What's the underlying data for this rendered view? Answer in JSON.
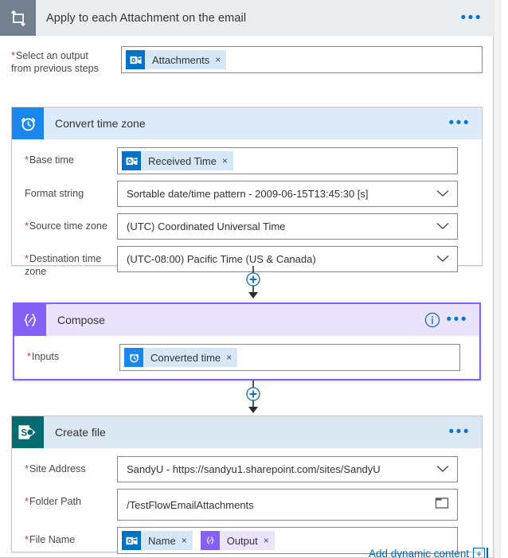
{
  "scope": {
    "title": "Apply to each Attachment on the email",
    "icon": "loop-icon",
    "menu_label": "•••",
    "field": {
      "label_line1": "Select an output",
      "label_line2": "from previous steps",
      "required": true,
      "token": {
        "text": "Attachments",
        "icon": "outlook-icon",
        "remove_label": "×"
      }
    }
  },
  "actions": [
    {
      "id": "convert-time-zone",
      "title": "Convert time zone",
      "icon": "alarm-clock-icon",
      "menu_label": "•••",
      "selected": false,
      "fields": [
        {
          "label": "Base time",
          "required": true,
          "type": "token",
          "token": {
            "text": "Received Time",
            "icon": "outlook-icon",
            "remove_label": "×"
          }
        },
        {
          "label": "Format string",
          "required": false,
          "type": "dropdown",
          "value": "Sortable date/time pattern - 2009-06-15T13:45:30 [s]"
        },
        {
          "label": "Source time zone",
          "required": true,
          "type": "dropdown",
          "value": "(UTC) Coordinated Universal Time"
        },
        {
          "label": "Destination time zone",
          "required": true,
          "type": "dropdown",
          "value": "(UTC-08:00) Pacific Time (US & Canada)"
        }
      ]
    },
    {
      "id": "compose",
      "title": "Compose",
      "icon": "compose-braces-icon",
      "menu_label": "•••",
      "info_label": "i",
      "selected": true,
      "fields": [
        {
          "label": "Inputs",
          "required": true,
          "type": "token",
          "token": {
            "text": "Converted time",
            "icon": "alarm-clock-icon",
            "remove_label": "×"
          }
        }
      ]
    },
    {
      "id": "create-file",
      "title": "Create file",
      "icon": "sharepoint-icon",
      "menu_label": "•••",
      "selected": false,
      "fields": [
        {
          "label": "Site Address",
          "required": true,
          "type": "dropdown",
          "value": "SandyU - https://sandyu1.sharepoint.com/sites/SandyU"
        },
        {
          "label": "Folder Path",
          "required": true,
          "type": "text-with-picker",
          "value": "/TestFlowEmailAttachments",
          "picker_icon": "folder-icon"
        },
        {
          "label": "File Name",
          "required": true,
          "type": "tokens",
          "tokens": [
            {
              "text": "Name",
              "icon": "outlook-icon",
              "remove_label": "×"
            },
            {
              "text": "Output",
              "icon": "compose-braces-icon",
              "remove_label": "×"
            }
          ]
        }
      ]
    }
  ],
  "connectors": [
    {
      "id": "connector-1",
      "add_label": "+"
    },
    {
      "id": "connector-2",
      "add_label": "+"
    }
  ],
  "footer": {
    "add_dynamic_content": "Add dynamic content",
    "add_dynamic_plus": "+"
  },
  "colors": {
    "scope_header_bg": "#eaedf0",
    "scope_icon_bg": "#72808f",
    "card_header_blue": "#dceafa",
    "card_header_purple": "#eae3fd",
    "accent_blue": "#0078d4",
    "compose_purple": "#8661f5",
    "required_red": "#d13438",
    "link_blue": "#0067b8"
  }
}
